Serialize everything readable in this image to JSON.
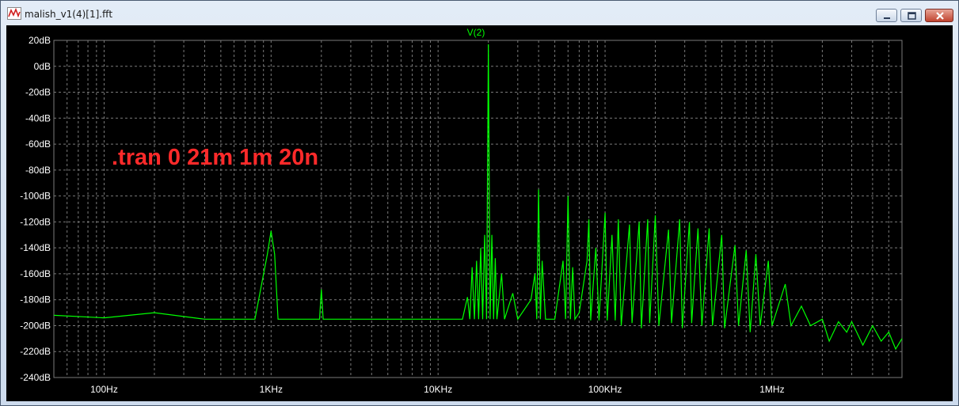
{
  "window": {
    "title": "malish_v1(4)[1].fft",
    "icon": "waveform-icon",
    "controls": [
      "minimize-icon",
      "maximize-icon",
      "close-icon"
    ]
  },
  "annotation": ".tran 0 21m 1m 20n",
  "colors": {
    "background": "#000000",
    "trace": "#00ff00",
    "grid": "#7a7a7a",
    "tick_labels": "#ffffff",
    "annotation": "#ff2a2a",
    "trace_label": "#00ff00"
  },
  "chart_data": {
    "type": "line",
    "title": "",
    "xlabel": "",
    "ylabel": "",
    "xscale": "log",
    "xlim": [
      50,
      6000000
    ],
    "ylim": [
      -240,
      20
    ],
    "grid": true,
    "legend_position": "top-center",
    "series": [
      {
        "name": "V(2)",
        "points": [
          [
            50,
            -192
          ],
          [
            100,
            -194
          ],
          [
            200,
            -190
          ],
          [
            400,
            -195
          ],
          [
            800,
            -195
          ],
          [
            950,
            -145
          ],
          [
            1000,
            -127
          ],
          [
            1050,
            -145
          ],
          [
            1100,
            -195
          ],
          [
            1500,
            -195
          ],
          [
            1950,
            -195
          ],
          [
            2000,
            -172
          ],
          [
            2050,
            -195
          ],
          [
            3000,
            -195
          ],
          [
            5000,
            -195
          ],
          [
            8000,
            -195
          ],
          [
            12000,
            -195
          ],
          [
            14000,
            -195
          ],
          [
            15000,
            -178
          ],
          [
            15500,
            -195
          ],
          [
            16000,
            -155
          ],
          [
            16500,
            -195
          ],
          [
            17000,
            -150
          ],
          [
            17500,
            -195
          ],
          [
            18000,
            -140
          ],
          [
            18500,
            -195
          ],
          [
            19000,
            -130
          ],
          [
            19500,
            -195
          ],
          [
            20000,
            17
          ],
          [
            20500,
            -195
          ],
          [
            21000,
            -130
          ],
          [
            21500,
            -195
          ],
          [
            22000,
            -148
          ],
          [
            22500,
            -195
          ],
          [
            24000,
            -160
          ],
          [
            25000,
            -195
          ],
          [
            28000,
            -175
          ],
          [
            30000,
            -195
          ],
          [
            36000,
            -180
          ],
          [
            38000,
            -160
          ],
          [
            39000,
            -195
          ],
          [
            40000,
            -95
          ],
          [
            41000,
            -195
          ],
          [
            42000,
            -150
          ],
          [
            44000,
            -195
          ],
          [
            50000,
            -195
          ],
          [
            56000,
            -150
          ],
          [
            58000,
            -195
          ],
          [
            60000,
            -100
          ],
          [
            62000,
            -195
          ],
          [
            64000,
            -155
          ],
          [
            66000,
            -195
          ],
          [
            70000,
            -190
          ],
          [
            78000,
            -150
          ],
          [
            80000,
            -118
          ],
          [
            82000,
            -196
          ],
          [
            88000,
            -140
          ],
          [
            92000,
            -196
          ],
          [
            100000,
            -113
          ],
          [
            103000,
            -196
          ],
          [
            110000,
            -130
          ],
          [
            115000,
            -196
          ],
          [
            120000,
            -118
          ],
          [
            125000,
            -200
          ],
          [
            140000,
            -122
          ],
          [
            145000,
            -198
          ],
          [
            160000,
            -120
          ],
          [
            165000,
            -202
          ],
          [
            180000,
            -118
          ],
          [
            185000,
            -198
          ],
          [
            200000,
            -115
          ],
          [
            210000,
            -200
          ],
          [
            240000,
            -126
          ],
          [
            250000,
            -198
          ],
          [
            280000,
            -118
          ],
          [
            290000,
            -202
          ],
          [
            320000,
            -120
          ],
          [
            330000,
            -198
          ],
          [
            360000,
            -125
          ],
          [
            380000,
            -200
          ],
          [
            420000,
            -125
          ],
          [
            440000,
            -200
          ],
          [
            500000,
            -130
          ],
          [
            520000,
            -202
          ],
          [
            600000,
            -138
          ],
          [
            630000,
            -200
          ],
          [
            700000,
            -142
          ],
          [
            740000,
            -205
          ],
          [
            800000,
            -145
          ],
          [
            850000,
            -200
          ],
          [
            950000,
            -150
          ],
          [
            1000000,
            -200
          ],
          [
            1200000,
            -168
          ],
          [
            1300000,
            -200
          ],
          [
            1500000,
            -185
          ],
          [
            1700000,
            -200
          ],
          [
            2000000,
            -195
          ],
          [
            2200000,
            -212
          ],
          [
            2500000,
            -197
          ],
          [
            2800000,
            -205
          ],
          [
            3000000,
            -197
          ],
          [
            3500000,
            -215
          ],
          [
            4000000,
            -200
          ],
          [
            4500000,
            -212
          ],
          [
            5000000,
            -205
          ],
          [
            5500000,
            -218
          ],
          [
            6000000,
            -210
          ]
        ]
      }
    ],
    "y_ticks": [
      "20dB",
      "0dB",
      "-20dB",
      "-40dB",
      "-60dB",
      "-80dB",
      "-100dB",
      "-120dB",
      "-140dB",
      "-160dB",
      "-180dB",
      "-200dB",
      "-220dB",
      "-240dB"
    ],
    "x_ticks": [
      {
        "label": "100Hz",
        "value": 100
      },
      {
        "label": "1KHz",
        "value": 1000
      },
      {
        "label": "10KHz",
        "value": 10000
      },
      {
        "label": "100KHz",
        "value": 100000
      },
      {
        "label": "1MHz",
        "value": 1000000
      }
    ]
  }
}
